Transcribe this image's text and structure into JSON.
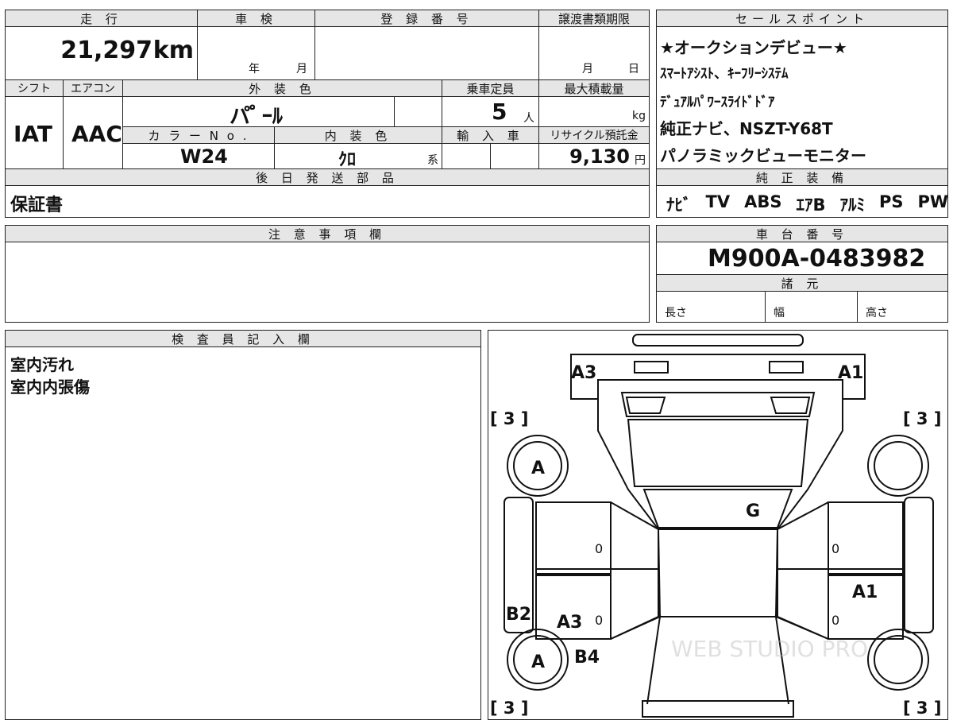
{
  "sheet": {
    "headers": {
      "mileage": "走 行",
      "inspection": "車 検",
      "registration": "登 録 番 号",
      "transfer_deadline": "譲渡書類期限",
      "sales_points": "セールスポイント",
      "shift": "シフト",
      "aircon": "エアコン",
      "exterior_color": "外 装 色",
      "capacity": "乗車定員",
      "max_load": "最大積載量",
      "color_no": "カ ラ ー N o .",
      "interior_color": "内 装 色",
      "import": "輸 入 車",
      "recycle": "リサイクル預託金",
      "later_parts": "後 日 発 送 部 品",
      "genuine_equipment": "純 正 装 備",
      "notes": "注 意 事 項 欄",
      "chassis": "車 台 番 号",
      "specs": "諸 元",
      "inspector": "検 査 員 記 入 欄"
    },
    "values": {
      "mileage": "21,297",
      "mileage_unit": "km",
      "year_label": "年",
      "month_label": "月",
      "deadline_month": "月",
      "deadline_day": "日",
      "shift": "IAT",
      "aircon": "AAC",
      "exterior_color": "パ ゚ ｰﾙ",
      "capacity": "5",
      "capacity_unit": "人",
      "load_unit": "kg",
      "color_no": "W24",
      "interior_color": "ｸﾛ",
      "interior_suffix": "系",
      "recycle": "9,130",
      "recycle_unit": "円",
      "later_parts": "保証書",
      "chassis": "M900A-0483982",
      "length_label": "長さ",
      "width_label": "幅",
      "height_label": "高さ"
    },
    "sales_points": [
      "★オークションデビュー★",
      "ｽﾏｰﾄｱｼｽﾄ、ｷｰﾌﾘｰｼｽﾃﾑ",
      "ﾃﾞｭｱﾙﾊﾟﾜｰｽﾗｲﾄﾞﾄﾞｱ",
      "純正ナビ、NSZT-Y68T",
      "パノラミックビューモニター"
    ],
    "equipment": [
      "ﾅﾋﾞ",
      "TV",
      "ABS",
      "ｴｱB",
      "ｱﾙﾐ",
      "PS",
      "PW"
    ],
    "inspector_notes": [
      "室内汚れ",
      "室内内張傷"
    ],
    "diagram": {
      "marks": {
        "front_left": "A3",
        "front_right": "A1",
        "tire_fl": "[ 3 ]",
        "tire_fr": "[ 3 ]",
        "tire_rl": "[ 3 ]",
        "tire_rr": "[ 3 ]",
        "wheel_front_left": "A",
        "wheel_rear_left": "A",
        "windshield": "G",
        "left_sill": "B2",
        "left_rear_door": "A3",
        "left_rear_fender": "B4",
        "right_rear_door": "A1",
        "zero": "0"
      },
      "watermark": "WEB STUDIO PRO"
    }
  }
}
